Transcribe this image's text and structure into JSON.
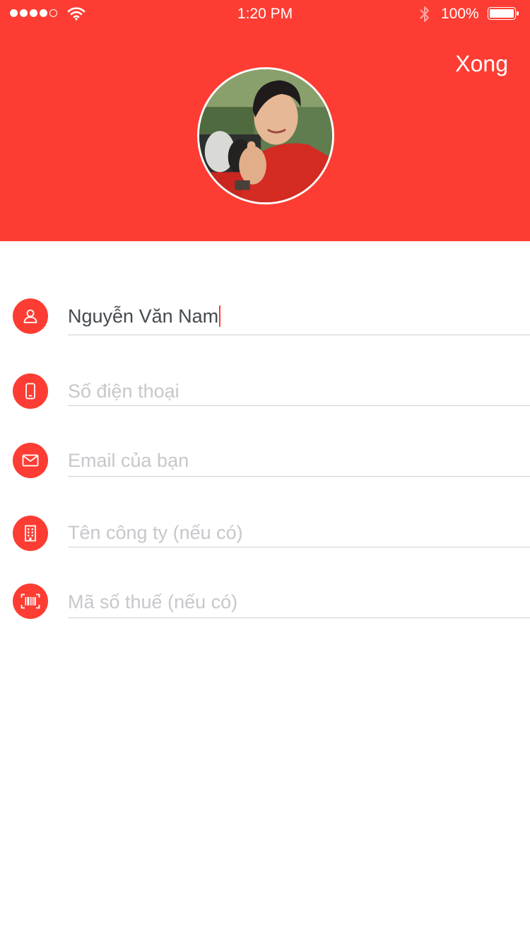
{
  "status_bar": {
    "time": "1:20 PM",
    "battery_percent": "100%",
    "signal_bars_filled": 4,
    "signal_bars_total": 5
  },
  "header": {
    "done_label": "Xong",
    "avatar": "profile-photo"
  },
  "form": {
    "name": {
      "value": "Nguyễn Văn Nam",
      "icon": "user-icon"
    },
    "phone": {
      "placeholder": "Số điện thoại",
      "icon": "phone-icon"
    },
    "email": {
      "placeholder": "Email của bạn",
      "icon": "mail-icon"
    },
    "company": {
      "placeholder": "Tên công ty (nếu có)",
      "icon": "building-icon"
    },
    "tax_code": {
      "placeholder": "Mã số thuế (nếu có)",
      "icon": "barcode-icon"
    }
  },
  "colors": {
    "accent": "#fd3d33",
    "text": "#444a4e",
    "placeholder": "#c7c7cc",
    "divider": "#cfcfcf"
  }
}
